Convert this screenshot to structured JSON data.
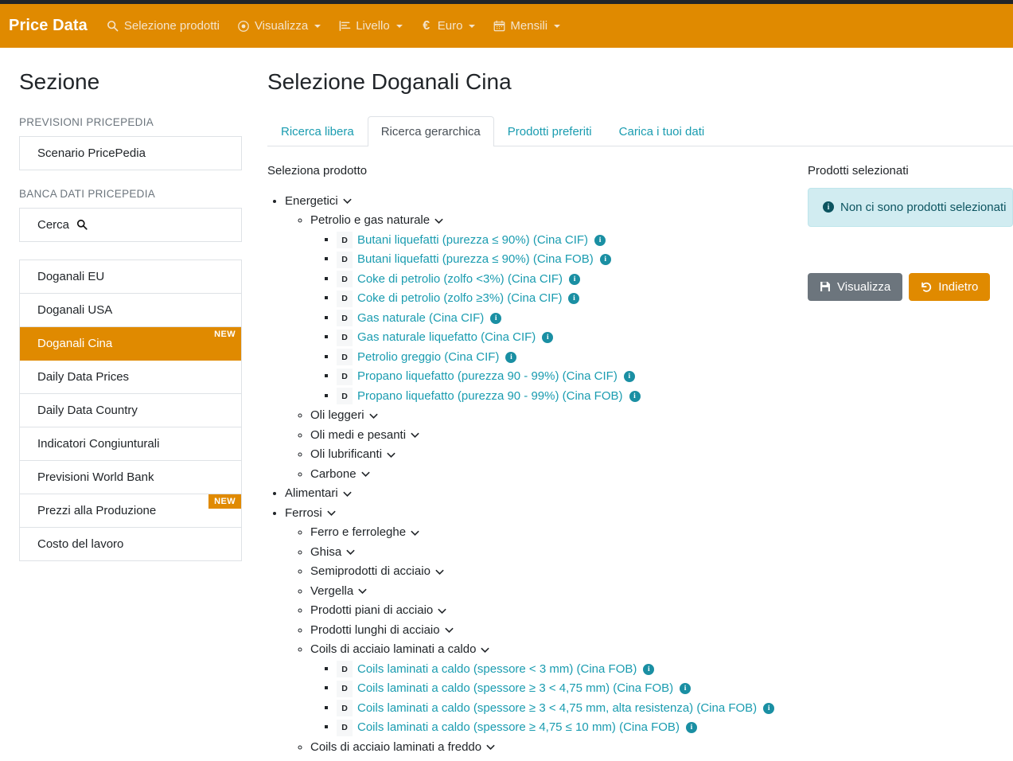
{
  "navbar": {
    "brand": "Price Data",
    "items": [
      {
        "label": "Selezione prodotti",
        "icon": "search-icon",
        "caret": false
      },
      {
        "label": "Visualizza",
        "icon": "eye-icon",
        "caret": true
      },
      {
        "label": "Livello",
        "icon": "align-left-chart-icon",
        "caret": true
      },
      {
        "label": "Euro",
        "icon": "euro-icon",
        "caret": true
      },
      {
        "label": "Mensili",
        "icon": "calendar-icon",
        "caret": true
      }
    ]
  },
  "sidebar": {
    "title": "Sezione",
    "group1_label": "PREVISIONI PRICEPEDIA",
    "group1_items": [
      {
        "label": "Scenario PricePedia",
        "active": false,
        "badge": ""
      }
    ],
    "group2_label": "BANCA DATI PRICEPEDIA",
    "search": {
      "label": "Cerca",
      "icon": "search-icon"
    },
    "group2_items": [
      {
        "label": "Doganali EU",
        "active": false,
        "badge": ""
      },
      {
        "label": "Doganali USA",
        "active": false,
        "badge": ""
      },
      {
        "label": "Doganali Cina",
        "active": true,
        "badge": "NEW"
      },
      {
        "label": "Daily Data Prices",
        "active": false,
        "badge": ""
      },
      {
        "label": "Daily Data Country",
        "active": false,
        "badge": ""
      },
      {
        "label": "Indicatori Congiunturali",
        "active": false,
        "badge": ""
      },
      {
        "label": "Previsioni World Bank",
        "active": false,
        "badge": ""
      },
      {
        "label": "Prezzi alla Produzione",
        "active": false,
        "badge": "NEW"
      },
      {
        "label": "Costo del lavoro",
        "active": false,
        "badge": ""
      }
    ]
  },
  "main": {
    "page_title": "Selezione Doganali Cina",
    "tabs": [
      {
        "label": "Ricerca libera",
        "active": false
      },
      {
        "label": "Ricerca gerarchica",
        "active": true
      },
      {
        "label": "Prodotti preferiti",
        "active": false
      },
      {
        "label": "Carica i tuoi dati",
        "active": false
      }
    ],
    "tree_label": "Seleziona prodotto",
    "selected_label": "Prodotti selezionati",
    "alert_text": "Non ci sono prodotti selezionati",
    "buttons": [
      {
        "label": "Visualizza",
        "icon": "save-icon",
        "style": "secondary"
      },
      {
        "label": "Indietro",
        "icon": "undo-icon",
        "style": "warning"
      }
    ]
  },
  "tree": [
    {
      "label": "Energetici",
      "children": [
        {
          "label": "Petrolio e gas naturale",
          "leaves": [
            {
              "badge": "D",
              "label": "Butani liquefatti (purezza ≤ 90%) (Cina CIF)"
            },
            {
              "badge": "D",
              "label": "Butani liquefatti (purezza ≤ 90%) (Cina FOB)"
            },
            {
              "badge": "D",
              "label": "Coke di petrolio (zolfo <3%) (Cina CIF)"
            },
            {
              "badge": "D",
              "label": "Coke di petrolio (zolfo ≥3%) (Cina CIF)"
            },
            {
              "badge": "D",
              "label": "Gas naturale (Cina CIF)"
            },
            {
              "badge": "D",
              "label": "Gas naturale liquefatto (Cina CIF)"
            },
            {
              "badge": "D",
              "label": "Petrolio greggio (Cina CIF)"
            },
            {
              "badge": "D",
              "label": "Propano liquefatto (purezza 90 - 99%) (Cina CIF)"
            },
            {
              "badge": "D",
              "label": "Propano liquefatto (purezza 90 - 99%) (Cina FOB)"
            }
          ]
        },
        {
          "label": "Oli leggeri",
          "leaves": []
        },
        {
          "label": "Oli medi e pesanti",
          "leaves": []
        },
        {
          "label": "Oli lubrificanti",
          "leaves": []
        },
        {
          "label": "Carbone",
          "leaves": []
        }
      ]
    },
    {
      "label": "Alimentari",
      "children": []
    },
    {
      "label": "Ferrosi",
      "children": [
        {
          "label": "Ferro e ferroleghe",
          "leaves": []
        },
        {
          "label": "Ghisa",
          "leaves": []
        },
        {
          "label": "Semiprodotti di acciaio",
          "leaves": []
        },
        {
          "label": "Vergella",
          "leaves": []
        },
        {
          "label": "Prodotti piani di acciaio",
          "leaves": []
        },
        {
          "label": "Prodotti lunghi di acciaio",
          "leaves": []
        },
        {
          "label": "Coils di acciaio laminati a caldo",
          "leaves": [
            {
              "badge": "D",
              "label": "Coils laminati a caldo (spessore < 3 mm) (Cina FOB)"
            },
            {
              "badge": "D",
              "label": "Coils laminati a caldo (spessore ≥ 3 < 4,75 mm) (Cina FOB)"
            },
            {
              "badge": "D",
              "label": "Coils laminati a caldo (spessore ≥ 3 < 4,75 mm, alta resistenza) (Cina FOB)"
            },
            {
              "badge": "D",
              "label": "Coils laminati a caldo (spessore ≥ 4,75 ≤ 10 mm) (Cina FOB)"
            }
          ]
        },
        {
          "label": "Coils di acciaio laminati a freddo",
          "leaves": []
        }
      ]
    }
  ],
  "colors": {
    "brand_orange": "#e08a00",
    "link_teal": "#1a9cb0",
    "alert_bg": "#d1ecf1",
    "alert_text": "#0c5460",
    "secondary_gray": "#6c757d"
  }
}
